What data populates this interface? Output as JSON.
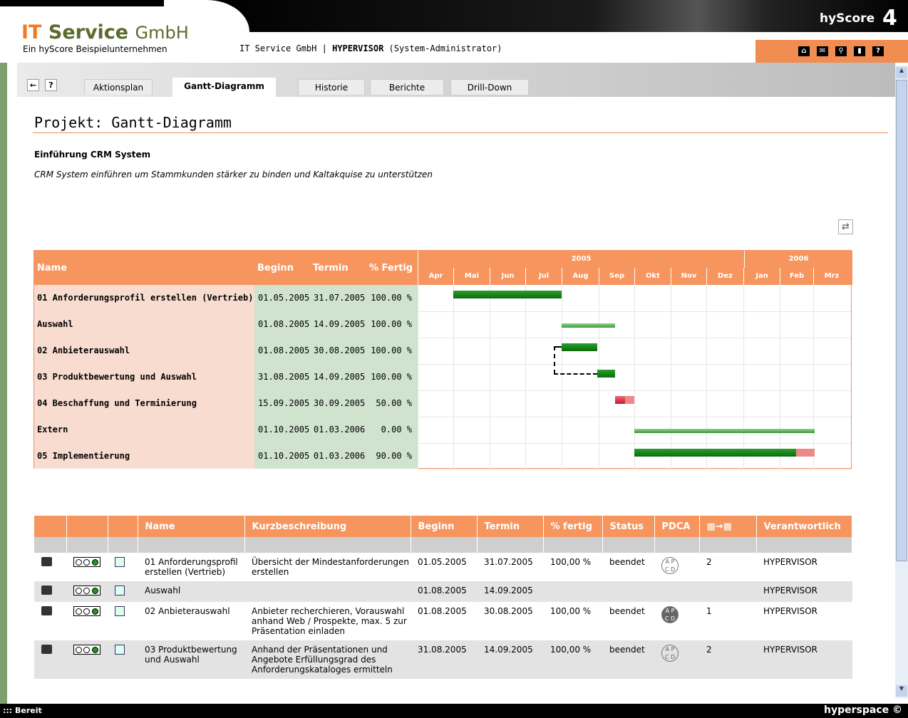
{
  "header": {
    "logo_main_1": "IT",
    "logo_main_2": "Service",
    "logo_main_3": "GmbH",
    "logo_sub": "Ein hyScore Beispielunternehmen",
    "info_prefix": "IT Service GmbH |",
    "info_user": "HYPERVISOR",
    "info_role": "(System-Administrator)",
    "brand": "hyScore",
    "brand_version": "4",
    "icons": [
      "home-icon",
      "mail-icon",
      "search-icon",
      "book-icon",
      "help-icon"
    ]
  },
  "tabs": {
    "back": "←",
    "help": "?",
    "items": [
      "Aktionsplan",
      "Gantt-Diagramm",
      "Historie",
      "Berichte",
      "Drill-Down"
    ],
    "active": "Gantt-Diagramm"
  },
  "page": {
    "title": "Projekt: Gantt-Diagramm",
    "project_name": "Einführung CRM System",
    "project_desc": "CRM System einführen um Stammkunden stärker zu binden und Kaltakquise zu unterstützen"
  },
  "gantt": {
    "headers": {
      "name": "Name",
      "begin": "Beginn",
      "end": "Termin",
      "pct": "% Fertig"
    },
    "years": [
      "2005",
      "2006"
    ],
    "months": [
      "Apr",
      "Mai",
      "Jun",
      "Jul",
      "Aug",
      "Sep",
      "Okt",
      "Nov",
      "Dez",
      "Jan",
      "Feb",
      "Mrz"
    ],
    "rows": [
      {
        "name": "01 Anforderungsprofil erstellen (Vertrieb)",
        "begin": "01.05.2005",
        "end": "31.07.2005",
        "pct": "100.00 %"
      },
      {
        "name": "Auswahl",
        "begin": "01.08.2005",
        "end": "14.09.2005",
        "pct": "100.00 %"
      },
      {
        "name": "02 Anbieterauswahl",
        "begin": "01.08.2005",
        "end": "30.08.2005",
        "pct": "100.00 %"
      },
      {
        "name": "03 Produktbewertung und Auswahl",
        "begin": "31.08.2005",
        "end": "14.09.2005",
        "pct": "100.00 %"
      },
      {
        "name": "04 Beschaffung und Terminierung",
        "begin": "15.09.2005",
        "end": "30.09.2005",
        "pct": "50.00 %"
      },
      {
        "name": "Extern",
        "begin": "01.10.2005",
        "end": "01.03.2006",
        "pct": "0.00 %"
      },
      {
        "name": "05 Implementierung",
        "begin": "01.10.2005",
        "end": "01.03.2006",
        "pct": "90.00 %"
      }
    ]
  },
  "table": {
    "headers": [
      "",
      "",
      "",
      "Name",
      "Kurzbeschreibung",
      "Beginn",
      "Termin",
      "% fertig",
      "Status",
      "PDCA",
      "",
      "Verantwortlich"
    ],
    "rows": [
      {
        "name": "01 Anforderungsprofil erstellen (Vertrieb)",
        "desc": "Übersicht der Mindestanforderungen erstellen",
        "begin": "01.05.2005",
        "end": "31.07.2005",
        "pct": "100,00 %",
        "status": "beendet",
        "pdca": "A P C D",
        "dep": "2",
        "owner": "HYPERVISOR"
      },
      {
        "name": "Auswahl",
        "desc": "",
        "begin": "01.08.2005",
        "end": "14.09.2005",
        "pct": "",
        "status": "",
        "pdca": "",
        "dep": "",
        "owner": "HYPERVISOR"
      },
      {
        "name": "02 Anbieterauswahl",
        "desc": "Anbieter recherchieren, Vorauswahl anhand Web / Prospekte, max. 5 zur Präsentation einladen",
        "begin": "01.08.2005",
        "end": "30.08.2005",
        "pct": "100,00 %",
        "status": "beendet",
        "pdca": "A P C D",
        "dep": "1",
        "owner": "HYPERVISOR"
      },
      {
        "name": "03 Produktbewertung und Auswahl",
        "desc": "Anhand der Präsentationen und Angebote Erfüllungsgrad des Anforderungskataloges ermitteln",
        "begin": "31.08.2005",
        "end": "14.09.2005",
        "pct": "100,00 %",
        "status": "beendet",
        "pdca": "A P C D",
        "dep": "2",
        "owner": "HYPERVISOR"
      }
    ]
  },
  "status": {
    "left": "::: Bereit",
    "right": "hyperspace"
  }
}
